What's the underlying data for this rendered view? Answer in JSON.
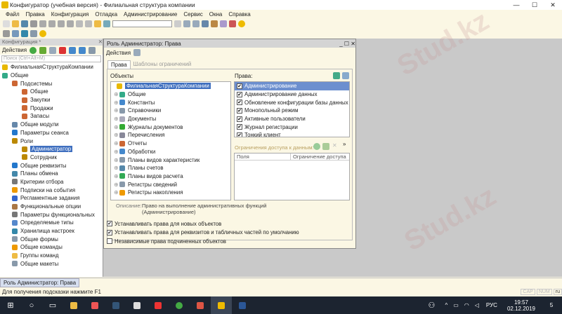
{
  "app": {
    "title": "Конфигуратор (учебная версия) - Филиальная структура компании"
  },
  "menu": [
    "Файл",
    "Правка",
    "Конфигурация",
    "Отладка",
    "Администрирование",
    "Сервис",
    "Окна",
    "Справка"
  ],
  "left_panel": {
    "title": "Конфигурация *",
    "actions": "Действия",
    "search_placeholder": "Поиск (Ctrl+Alt+M)",
    "tree": [
      {
        "label": "ФилиальнаяСтруктураКомпании",
        "level": 0,
        "color": "#e8b800"
      },
      {
        "label": "Общие",
        "level": 0,
        "color": "#3a8"
      },
      {
        "label": "Подсистемы",
        "level": 1,
        "color": "#c63"
      },
      {
        "label": "Общие",
        "level": 2,
        "color": "#c63"
      },
      {
        "label": "Закупки",
        "level": 2,
        "color": "#c63"
      },
      {
        "label": "Продажи",
        "level": 2,
        "color": "#c63"
      },
      {
        "label": "Запасы",
        "level": 2,
        "color": "#c63"
      },
      {
        "label": "Общие модули",
        "level": 1,
        "color": "#68a"
      },
      {
        "label": "Параметры сеанса",
        "level": 1,
        "color": "#27c"
      },
      {
        "label": "Роли",
        "level": 1,
        "color": "#b80"
      },
      {
        "label": "Администратор",
        "level": 2,
        "color": "#b80",
        "selected": true
      },
      {
        "label": "Сотрудник",
        "level": 2,
        "color": "#b80"
      },
      {
        "label": "Общие реквизиты",
        "level": 1,
        "color": "#27c"
      },
      {
        "label": "Планы обмена",
        "level": 1,
        "color": "#48a"
      },
      {
        "label": "Критерии отбора",
        "level": 1,
        "color": "#777"
      },
      {
        "label": "Подписки на события",
        "level": 1,
        "color": "#e90"
      },
      {
        "label": "Регламентные задания",
        "level": 1,
        "color": "#36c"
      },
      {
        "label": "Функциональные опции",
        "level": 1,
        "color": "#a74"
      },
      {
        "label": "Параметры функциональных",
        "level": 1,
        "color": "#777"
      },
      {
        "label": "Определяемые типы",
        "level": 1,
        "color": "#58c"
      },
      {
        "label": "Хранилища настроек",
        "level": 1,
        "color": "#38a"
      },
      {
        "label": "Общие формы",
        "level": 1,
        "color": "#89a"
      },
      {
        "label": "Общие команды",
        "level": 1,
        "color": "#e90"
      },
      {
        "label": "Группы команд",
        "level": 1,
        "color": "#eb4"
      },
      {
        "label": "Общие макеты",
        "level": 1,
        "color": "#89a"
      }
    ]
  },
  "role_window": {
    "title": "Роль Администратор: Права",
    "actions": "Действия",
    "tabs": [
      "Права",
      "Шаблоны ограничений"
    ],
    "objects_label": "Объекты",
    "objects": [
      {
        "label": "ФилиальнаяСтруктураКомпании",
        "selected": true,
        "color": "#e8b800"
      },
      {
        "label": "Общие",
        "color": "#3a8"
      },
      {
        "label": "Константы",
        "color": "#48c"
      },
      {
        "label": "Справочники",
        "color": "#89a"
      },
      {
        "label": "Документы",
        "color": "#aab"
      },
      {
        "label": "Журналы документов",
        "color": "#3a3"
      },
      {
        "label": "Перечисления",
        "color": "#889"
      },
      {
        "label": "Отчеты",
        "color": "#c63"
      },
      {
        "label": "Обработки",
        "color": "#48c"
      },
      {
        "label": "Планы видов характеристик",
        "color": "#89a"
      },
      {
        "label": "Планы счетов",
        "color": "#58a"
      },
      {
        "label": "Планы видов расчета",
        "color": "#3a5"
      },
      {
        "label": "Регистры сведений",
        "color": "#89a"
      },
      {
        "label": "Регистры накопления",
        "color": "#e90"
      }
    ],
    "rights_label": "Права:",
    "rights": [
      {
        "label": "Администрирование",
        "checked": true,
        "selected": true
      },
      {
        "label": "Администрирование данных",
        "checked": true
      },
      {
        "label": "Обновление конфигурации базы данных",
        "checked": true
      },
      {
        "label": "Монопольный режим",
        "checked": true
      },
      {
        "label": "Активные пользователи",
        "checked": true
      },
      {
        "label": "Журнал регистрации",
        "checked": true
      },
      {
        "label": "Тонкий клиент",
        "checked": true
      }
    ],
    "restrictions_label": "Ограничения доступа к данным:",
    "restrictions_columns": [
      "Поля",
      "Ограничение доступа"
    ],
    "description_label": "Описание:",
    "description": "Право на выполнение административных функций (Администрирование)",
    "options": [
      {
        "label": "Устанавливать права для новых объектов",
        "checked": true
      },
      {
        "label": "Устанавливать права для реквизитов и табличных частей по умолчанию",
        "checked": true
      },
      {
        "label": "Независимые права подчиненных объектов",
        "checked": false
      }
    ]
  },
  "window_tab": "Роль Администратор: Права",
  "status": {
    "hint": "Для получения подсказки нажмите F1",
    "cap": "CAP",
    "num": "NUM",
    "lang": "ru"
  },
  "taskbar": {
    "lang": "РУС",
    "time": "19:57",
    "date": "02.12.2019",
    "notifications": "5"
  },
  "watermark": "Stud.kz"
}
